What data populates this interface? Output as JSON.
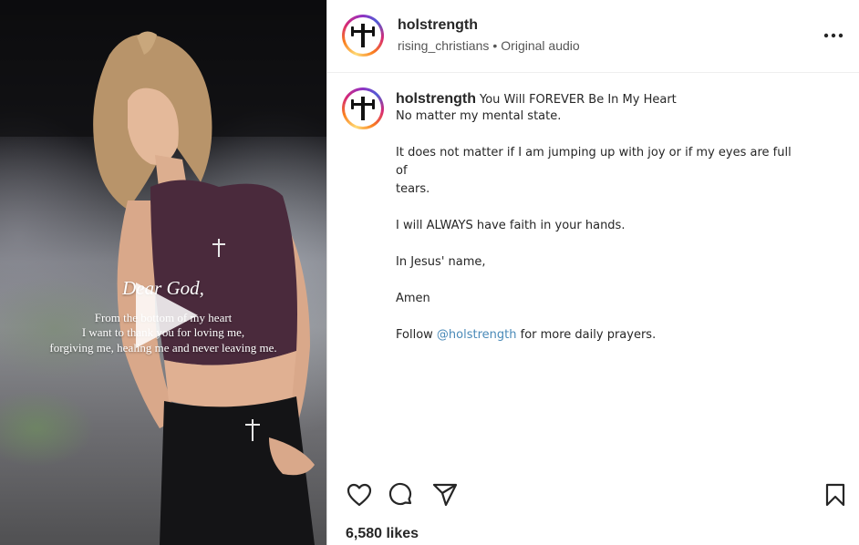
{
  "media": {
    "overlay_title": "Dear God,",
    "overlay_lines": [
      "From the bottom of my heart",
      "I want to thank you for loving me,",
      "forgiving me, healing me and never leaving me."
    ]
  },
  "header": {
    "username": "holstrength",
    "audio_owner": "rising_christians",
    "separator": "•",
    "audio_label": "Original audio"
  },
  "post": {
    "username": "holstrength",
    "title": "You Will FOREVER Be In My Heart",
    "paragraphs": [
      "No matter my mental state.",
      "It does not matter if I am jumping up with joy or if my eyes are full of",
      "tears.",
      "I will ALWAYS have faith in your hands.",
      "In Jesus' name,",
      "Amen"
    ],
    "follow_prefix": "Follow ",
    "follow_mention": "@holstrength",
    "follow_suffix": " for more daily prayers."
  },
  "engagement": {
    "likes": "6,580 likes"
  },
  "icons": {
    "avatar": "barbell-cross-icon",
    "play": "play-icon",
    "more": "more-horizontal-icon",
    "like": "heart-icon",
    "comment": "comment-icon",
    "share": "send-icon",
    "save": "bookmark-icon"
  },
  "colors": {
    "mention": "#4a8ab8",
    "text": "#262626"
  }
}
